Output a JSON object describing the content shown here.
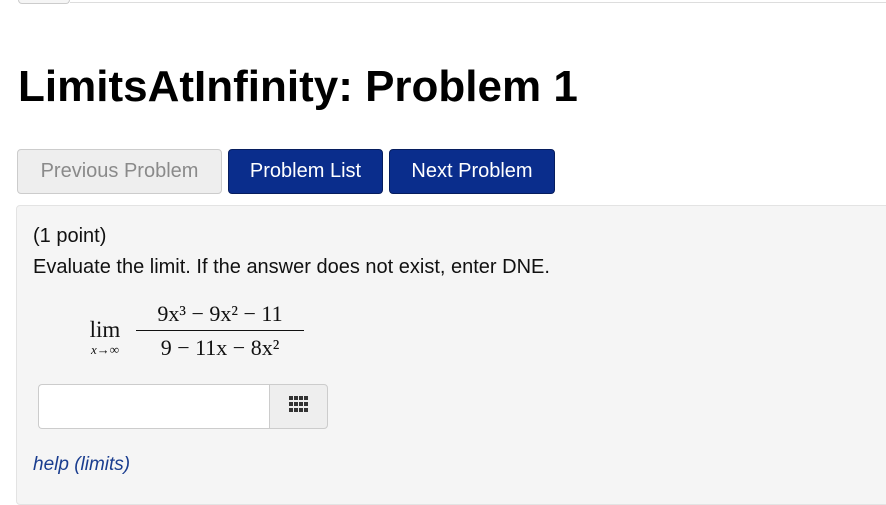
{
  "page": {
    "title": "LimitsAtInfinity: Problem 1"
  },
  "nav": {
    "previous_label": "Previous Problem",
    "list_label": "Problem List",
    "next_label": "Next Problem"
  },
  "problem": {
    "points": "(1 point)",
    "instructions": "Evaluate the limit. If the answer does not exist, enter DNE.",
    "math": {
      "lim": "lim",
      "lim_sub": "x→∞",
      "numerator": "9x³ − 9x² − 11",
      "denominator": "9 − 11x − 8x²"
    },
    "answer": {
      "value": "",
      "placeholder": ""
    },
    "keypad_icon": "keypad-grid-icon",
    "help_label": "help (limits)"
  },
  "colors": {
    "primary_button": "#0a2d8c",
    "disabled_button": "#eeeeee",
    "problem_background": "#f5f5f5",
    "link": "#1a3d8f"
  }
}
